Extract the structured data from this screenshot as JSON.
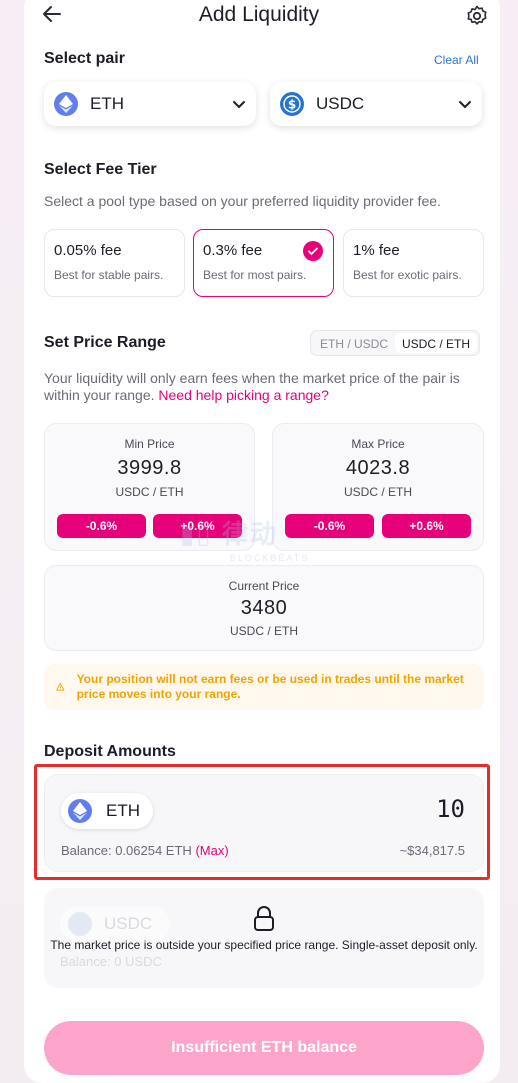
{
  "header": {
    "title": "Add Liquidity"
  },
  "pair": {
    "section_title": "Select pair",
    "clear_label": "Clear All",
    "token_a": "ETH",
    "token_b": "USDC"
  },
  "fee": {
    "section_title": "Select Fee Tier",
    "description": "Select a pool type based on your preferred liquidity provider fee.",
    "tiers": [
      {
        "label": "0.05% fee",
        "sub": "Best for stable pairs."
      },
      {
        "label": "0.3% fee",
        "sub": "Best for most pairs."
      },
      {
        "label": "1% fee",
        "sub": "Best for exotic pairs."
      }
    ],
    "selected": "0.3% fee"
  },
  "range": {
    "section_title": "Set Price Range",
    "toggle": [
      "ETH / USDC",
      "USDC / ETH"
    ],
    "toggle_active": "USDC / ETH",
    "info": "Your liquidity will only earn fees when the market price of the pair is within your range.",
    "help_link": "Need help picking a range?",
    "min": {
      "label": "Min Price",
      "value": "3999.8",
      "unit": "USDC / ETH",
      "dec": "-0.6%",
      "inc": "+0.6%"
    },
    "max": {
      "label": "Max Price",
      "value": "4023.8",
      "unit": "USDC / ETH",
      "dec": "-0.6%",
      "inc": "+0.6%"
    },
    "current": {
      "label": "Current Price",
      "value": "3480",
      "unit": "USDC / ETH"
    },
    "warning": "Your position will not earn fees or be used in trades until the market price moves into your range."
  },
  "deposit": {
    "section_title": "Deposit Amounts",
    "token": "ETH",
    "amount": "10",
    "balance_label": "Balance: ",
    "balance_value": "0.06254 ETH",
    "max_label": "(Max)",
    "usd_value": "~$34,817.5",
    "locked_token": "USDC",
    "locked_balance": "Balance: 0 USDC",
    "locked_message": "The market price is outside your specified price range. Single-asset deposit only."
  },
  "cta": {
    "label": "Insufficient ETH balance"
  },
  "colors": {
    "accent": "#e6007a",
    "cta_disabled": "#fca5cb",
    "highlight": "#e52d2d",
    "warning": "#f0a400"
  }
}
